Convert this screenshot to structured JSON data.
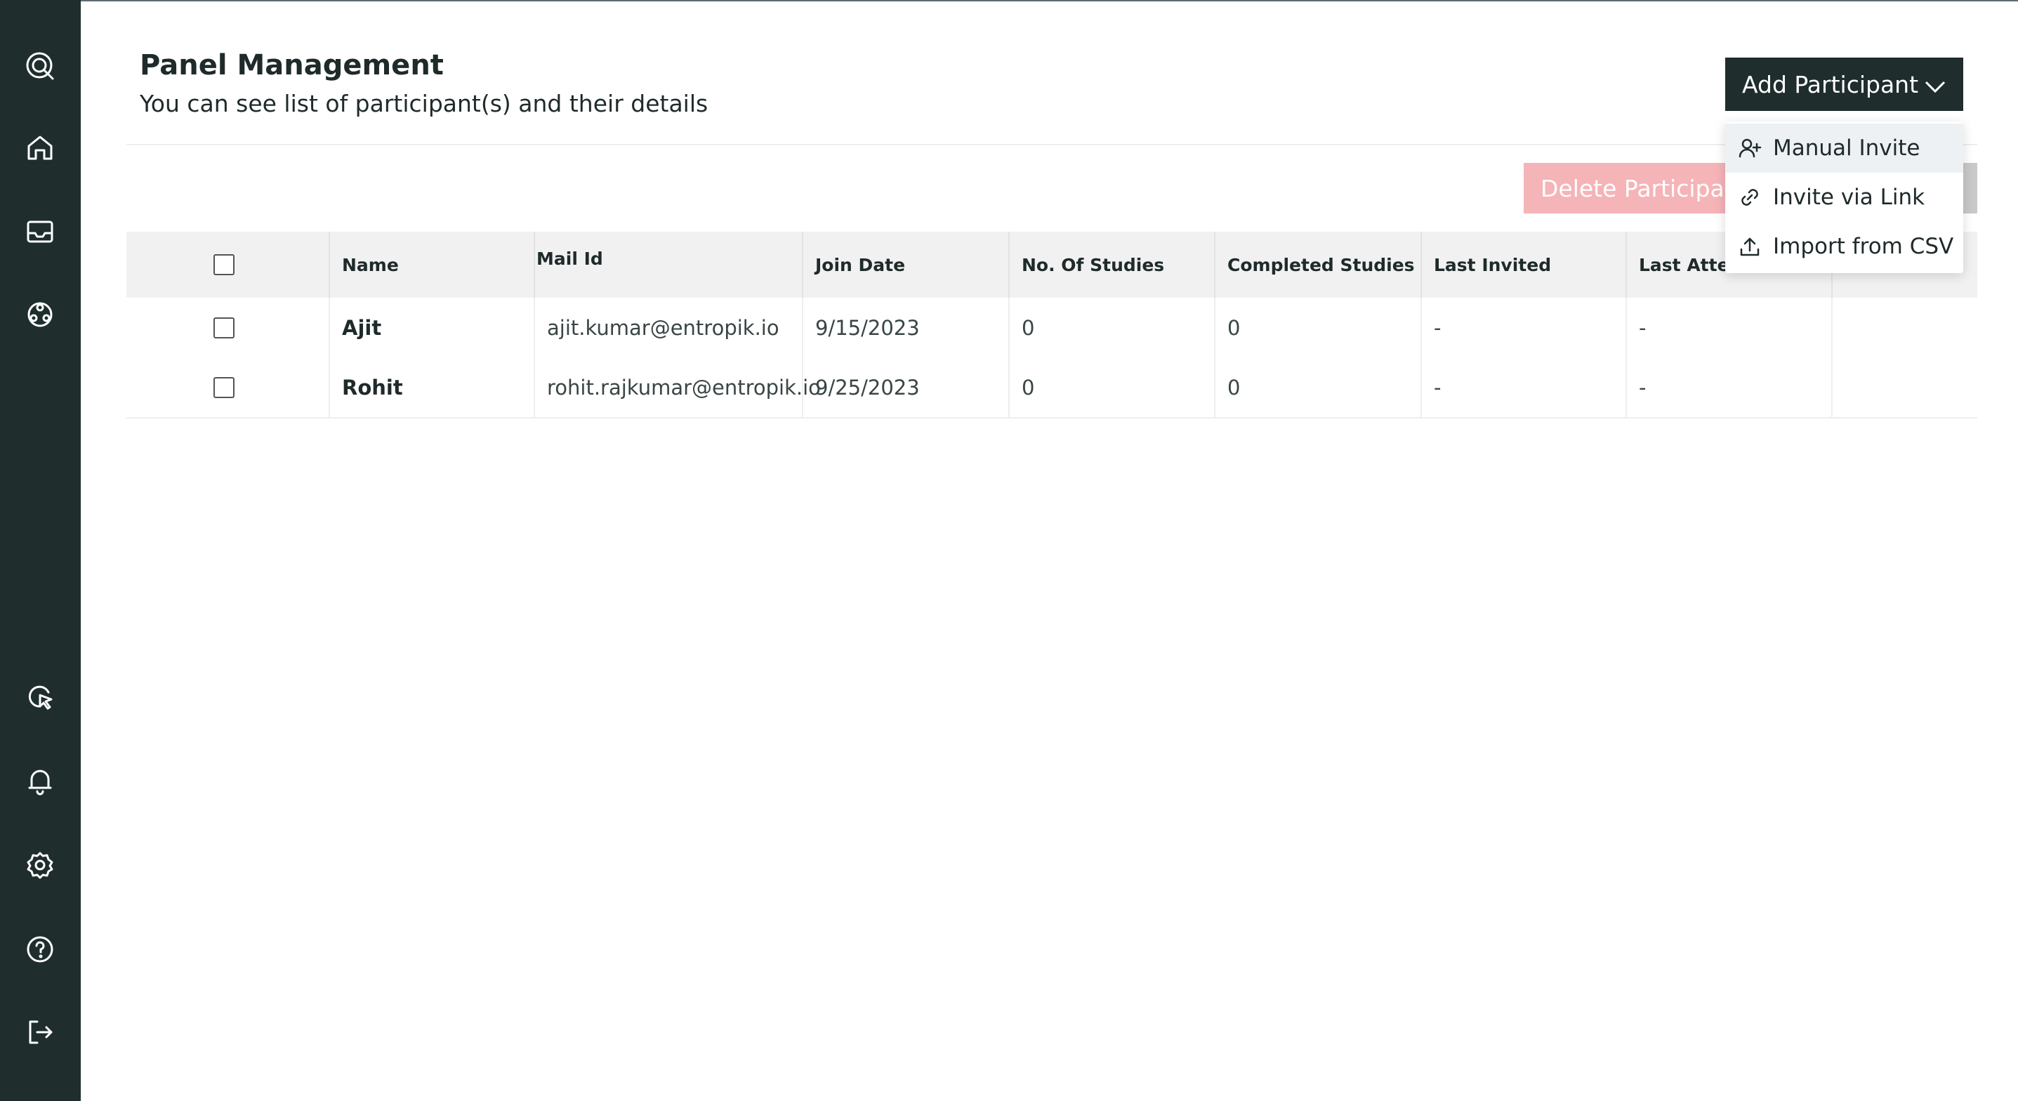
{
  "header": {
    "title": "Panel Management",
    "subtitle": "You can see list of participant(s) and their details"
  },
  "actions": {
    "add_participant": "Add Participant",
    "delete_participant": "Delete Participant"
  },
  "dropdown": {
    "items": [
      {
        "label": "Manual Invite",
        "icon": "user-plus-icon"
      },
      {
        "label": "Invite via Link",
        "icon": "link-icon"
      },
      {
        "label": "Import from CSV",
        "icon": "upload-icon"
      }
    ]
  },
  "sidebar": {
    "items": [
      "logo-icon",
      "home-icon",
      "inbox-icon",
      "panel-icon",
      "click-icon",
      "notification-icon",
      "settings-icon",
      "help-icon",
      "logout-icon"
    ]
  },
  "table": {
    "columns": [
      "Name",
      "Mail Id",
      "Join Date",
      "No. Of Studies",
      "Completed Studies",
      "Last Invited",
      "Last Attended"
    ],
    "rows": [
      {
        "name": "Ajit",
        "mail": "ajit.kumar@entropik.io",
        "join_date": "9/15/2023",
        "studies": "0",
        "completed": "0",
        "last_invited": "-",
        "last_attended": "-"
      },
      {
        "name": "Rohit",
        "mail": "rohit.rajkumar@entropik.io",
        "join_date": "9/25/2023",
        "studies": "0",
        "completed": "0",
        "last_invited": "-",
        "last_attended": "-"
      }
    ]
  },
  "colors": {
    "sidebar_bg": "#1f2d2d",
    "primary_button": "#1f2d2d",
    "delete_disabled": "#f5b4b8"
  }
}
